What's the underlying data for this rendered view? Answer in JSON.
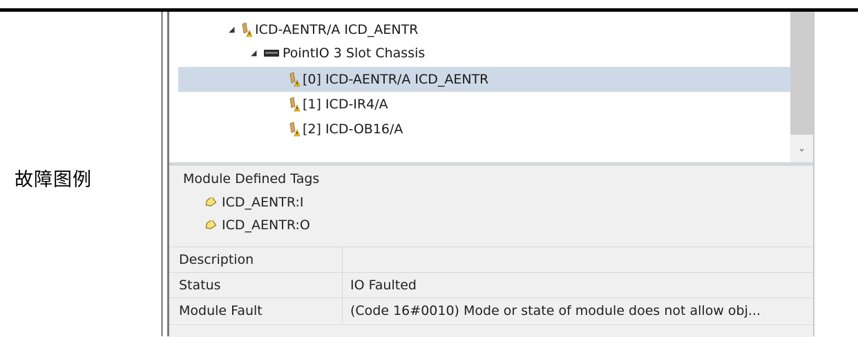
{
  "row_label": "故障图例",
  "tree": {
    "items": [
      {
        "label": "ICD-AENTR/A ICD_AENTR",
        "icon": "module-fault-icon",
        "expander": "◢"
      },
      {
        "label": "PointIO 3 Slot Chassis",
        "icon": "chassis-icon",
        "expander": "◢"
      },
      {
        "label": "[0] ICD-AENTR/A ICD_AENTR",
        "icon": "module-fault-icon",
        "selected": true
      },
      {
        "label": "[1] ICD-IR4/A",
        "icon": "module-fault-icon"
      },
      {
        "label": "[2] ICD-OB16/A",
        "icon": "module-fault-icon"
      }
    ],
    "scroll_down_glyph": "⌄"
  },
  "tags": {
    "title": "Module Defined Tags",
    "items": [
      "ICD_AENTR:I",
      "ICD_AENTR:O"
    ],
    "icon": "tag-icon"
  },
  "properties": [
    {
      "key": "Description",
      "value": ""
    },
    {
      "key": "Status",
      "value": "IO Faulted"
    },
    {
      "key": "Module Fault",
      "value": "(Code 16#0010) Mode or state of module does not allow obj..."
    }
  ],
  "colors": {
    "selection": "#cdd9e6",
    "panel_bg": "#f0f0f0",
    "warning_yellow": "#f2c200"
  }
}
